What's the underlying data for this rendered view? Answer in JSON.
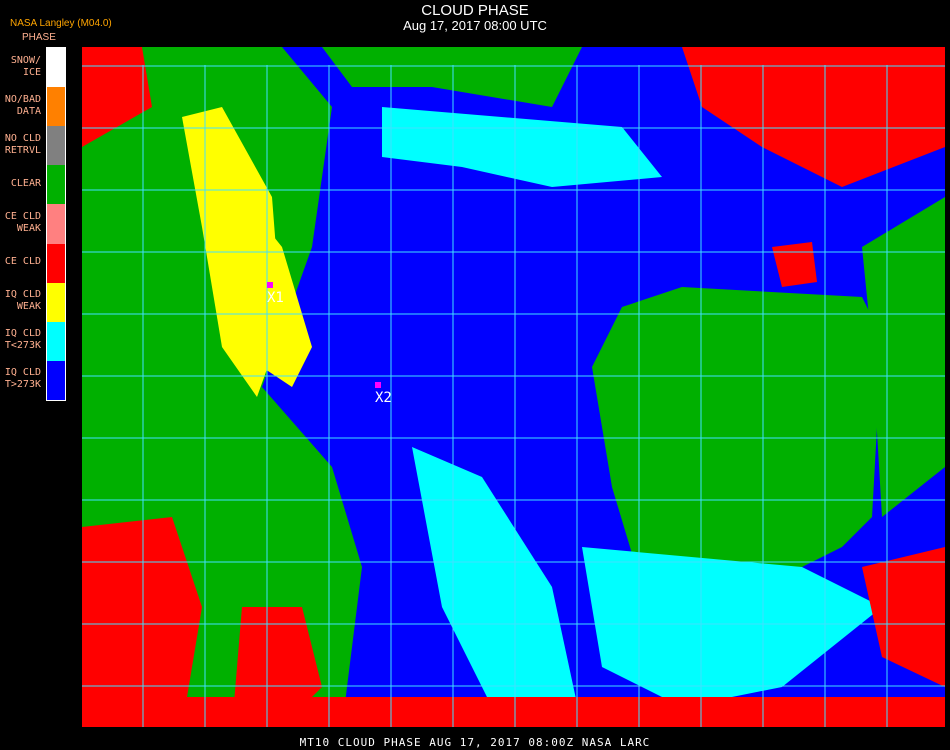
{
  "header": {
    "title": "CLOUD PHASE",
    "subtitle": "Aug 17, 2017 08:00 UTC",
    "org": "NASA Langley (M04.0)",
    "legend_title": "PHASE"
  },
  "legend": [
    {
      "l1": "SNOW/",
      "l2": "ICE",
      "color": "#ffffff"
    },
    {
      "l1": "NO/BAD",
      "l2": "DATA",
      "color": "#ff8000"
    },
    {
      "l1": "NO CLD",
      "l2": "RETRVL",
      "color": "#808080"
    },
    {
      "l1": "CLEAR",
      "l2": "",
      "color": "#00b000"
    },
    {
      "l1": "CE CLD",
      "l2": "WEAK",
      "color": "#ff8080"
    },
    {
      "l1": "CE CLD",
      "l2": "",
      "color": "#ff0000"
    },
    {
      "l1": "IQ CLD",
      "l2": "WEAK",
      "color": "#ffff00"
    },
    {
      "l1": "IQ CLD",
      "l2": "T<273K",
      "color": "#00ffff"
    },
    {
      "l1": "IQ CLD",
      "l2": "T>273K",
      "color": "#0000ff"
    }
  ],
  "markers": [
    {
      "label": "X1",
      "color": "#ff00ff"
    },
    {
      "label": "X2",
      "color": "#ff00ff"
    }
  ],
  "grid_color": "#40e0ff",
  "footer": "MT10  CLOUD PHASE   AUG 17, 2017 08:00Z   NASA LARC"
}
